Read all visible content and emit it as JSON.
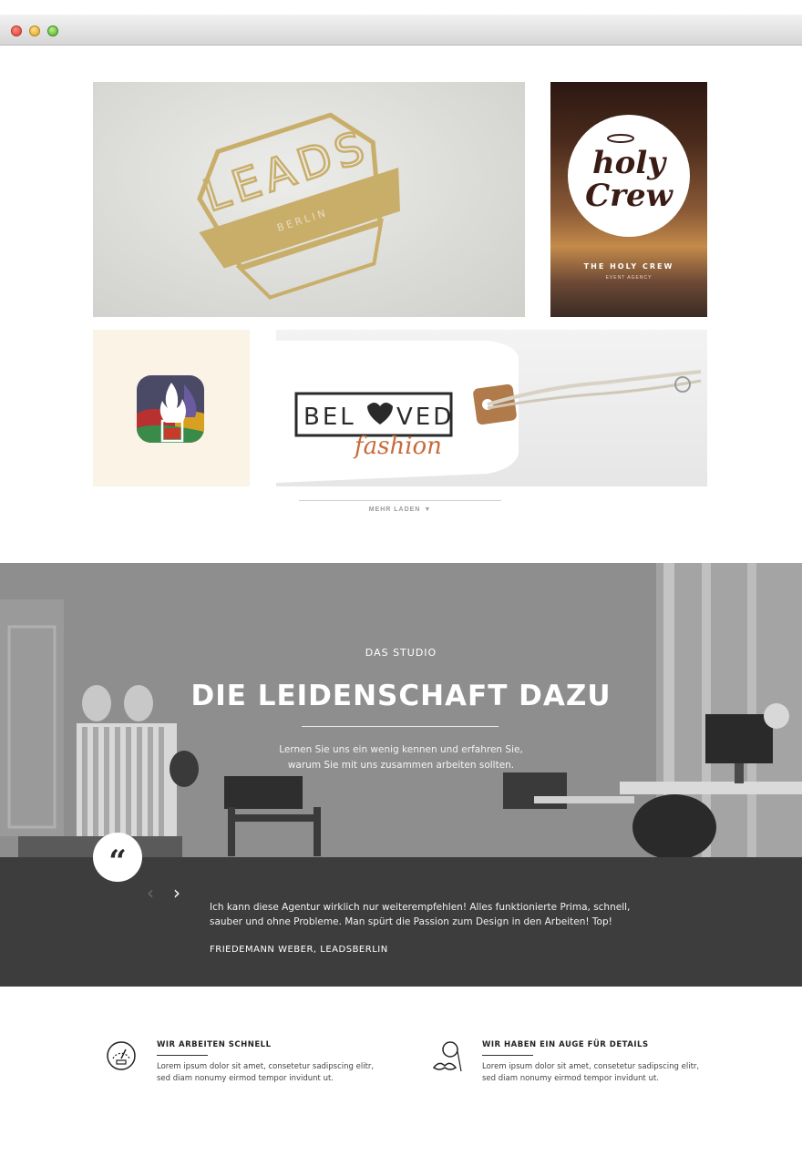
{
  "browser": {
    "buttons": [
      "close",
      "minimize",
      "maximize"
    ]
  },
  "portfolio": {
    "leads": {
      "logo_text": "LEADS",
      "logo_sub": "BERLIN",
      "gold": "#c9ae6a"
    },
    "holy_crew": {
      "logo_line1": "holy",
      "logo_line2": "Crew",
      "title": "THE HOLY CREW",
      "subtitle": "EVENT AGENCY"
    },
    "app_icon": {
      "icon": "flame-glass-icon"
    },
    "beloved": {
      "logo_left": "BEL",
      "logo_right": "VED",
      "script": "fashion"
    },
    "load_more": {
      "label": "MEHR LADEN",
      "icon": "triangle-down-icon"
    }
  },
  "studio": {
    "eyebrow": "DAS STUDIO",
    "title": "DIE LEIDENSCHAFT DAZU",
    "text_line1": "Lernen Sie uns ein wenig kennen und erfahren Sie,",
    "text_line2": "warum Sie mit uns zusammen arbeiten sollten."
  },
  "testimonial": {
    "quote_mark": "“",
    "prev_label": "‹",
    "next_label": "›",
    "text": "Ich kann diese Agentur wirklich nur weiterempfehlen! Alles funktionierte Prima, schnell, sauber und ohne Probleme. Man spürt die Passion zum Design in den Arbeiten! Top!",
    "author": "FRIEDEMANN WEBER, LEADSBERLIN"
  },
  "features": [
    {
      "icon": "speedometer-icon",
      "title": "WIR ARBEITEN SCHNELL",
      "text": "Lorem ipsum dolor sit amet, consetetur sadipscing elitr, sed diam nonumy eirmod tempor invidunt ut."
    },
    {
      "icon": "monocle-mustache-icon",
      "title": "WIR HABEN EIN AUGE FÜR DETAILS",
      "text": "Lorem ipsum dolor sit amet, consetetur sadipscing elitr, sed diam nonumy eirmod tempor invidunt ut."
    }
  ]
}
